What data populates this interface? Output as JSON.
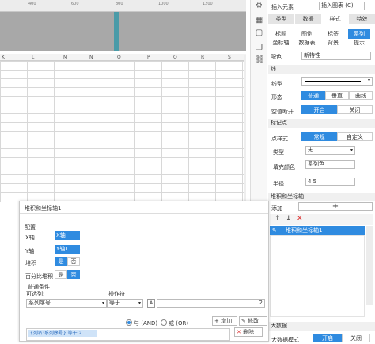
{
  "ruler": {
    "ticks": [
      "400",
      "600",
      "800",
      "1000",
      "1200"
    ]
  },
  "columns": [
    "K",
    "L",
    "M",
    "N",
    "O",
    "P",
    "Q",
    "R",
    "S"
  ],
  "panel": {
    "top_labels": {
      "insert_element": "插入元素",
      "insert_chart": "插入图表 (C)"
    },
    "main_tabs": [
      "类型",
      "数据",
      "样式",
      "特效"
    ],
    "sub_tabs": [
      "标题",
      "图例",
      "标签",
      "系列",
      "坐标轴",
      "数据表",
      "背景",
      "提示"
    ],
    "color_label": "配色",
    "color_value": "新特性",
    "line_section": "线",
    "line_type_label": "线型",
    "shape_label": "形态",
    "shape_options": [
      "普通",
      "垂直",
      "曲线"
    ],
    "null_break_label": "空值断开",
    "null_break_options": [
      "开启",
      "关闭"
    ],
    "marker_section": "标记点",
    "marker_style_label": "点样式",
    "marker_style_options": [
      "常规",
      "自定义"
    ],
    "type_label": "类型",
    "type_value": "无",
    "fill_label": "填充颜色",
    "fill_value": "系列色",
    "radius_label": "半径",
    "radius_value": "4.5",
    "stack_section": "堆积和坐标轴",
    "add_label": "添加",
    "add_symbol": "+",
    "list_item": "堆积和坐标轴1",
    "bigdata_section": "大数据",
    "bigdata_mode_label": "大数据模式",
    "bigdata_on": "开启",
    "bigdata_off": "关闭"
  },
  "dialog": {
    "title": "堆积和坐标轴1",
    "config_label": "配置",
    "x_axis_label": "X轴",
    "x_axis_value": "X轴",
    "y_axis_label": "Y轴",
    "y_axis_value": "Y轴1",
    "stack_label": "堆积",
    "stack_yes": "是",
    "stack_no": "否",
    "percent_label": "百分比堆积",
    "percent_yes": "是",
    "percent_no": "否",
    "cond_label": "普通条件",
    "candidate_label": "可选列:",
    "candidate_value": "系列序号",
    "operator_label": "操作符",
    "operator_value": "等于",
    "value": "2",
    "and_label": "与 (AND)",
    "or_label": "或 (OR)",
    "add_button": "增加",
    "modify_button": "修改",
    "delete_button": "删除",
    "condition_text": "{列名:系列序号} 等于 2"
  }
}
